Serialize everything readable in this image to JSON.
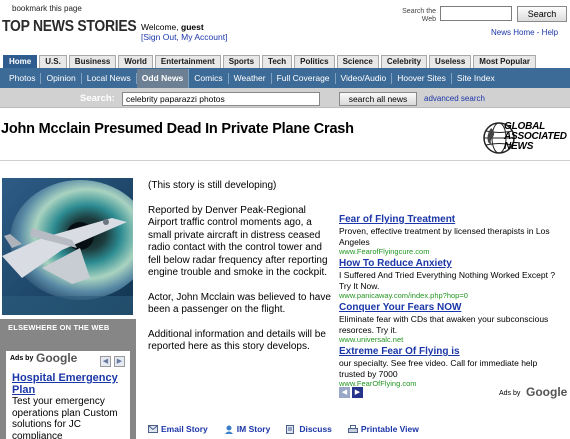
{
  "top": {
    "bookmark": "bookmark this page",
    "logo": "TOP NEWS STORIES",
    "welcome_prefix": "Welcome, ",
    "username": "guest",
    "sign_out": "[Sign Out, My Account]",
    "search_label": "Search the Web",
    "search_value": "",
    "search_button": "Search",
    "links": "News Home - Help"
  },
  "tabs": [
    {
      "label": "Home",
      "active": true
    },
    {
      "label": "U.S."
    },
    {
      "label": "Business"
    },
    {
      "label": "World"
    },
    {
      "label": "Entertainment"
    },
    {
      "label": "Sports"
    },
    {
      "label": "Tech"
    },
    {
      "label": "Politics"
    },
    {
      "label": "Science"
    },
    {
      "label": "Celebrity"
    },
    {
      "label": "Useless"
    },
    {
      "label": "Most Popular"
    }
  ],
  "subnav": [
    {
      "label": "Photos"
    },
    {
      "label": "Opinion"
    },
    {
      "label": "Local News"
    },
    {
      "label": "Odd News",
      "active": true
    },
    {
      "label": "Comics"
    },
    {
      "label": "Weather"
    },
    {
      "label": "Full Coverage"
    },
    {
      "label": "Video/Audio"
    },
    {
      "label": "Hoover Sites"
    },
    {
      "label": "Site Index"
    }
  ],
  "news_search": {
    "label": "Search:",
    "value": "celebrity paparazzi photos",
    "button": "search all news",
    "advanced": "advanced search"
  },
  "headline": "John Mcclain Presumed Dead In Private Plane Crash",
  "source_logo": {
    "line1": "GLOBAL",
    "line2": "ASSOCIATED",
    "line3": "NEWS"
  },
  "story": [
    "(This story is still developing)",
    "Reported by Denver Peak-Regional Airport traffic control moments ago, a small private aircraft in distress ceased radio contact with the control tower and fell below radar frequency after reporting engine trouble and smoke in the cockpit.",
    "Actor, John Mcclain was believed to have been a passenger on the flight.",
    "Additional information and details will be reported here as this story develops."
  ],
  "elsewhere": {
    "title": "ELSEWHERE ON THE WEB",
    "ads_by": "Ads by",
    "google": "Google",
    "ad_title": "Hospital Emergency Plan",
    "ad_body": "Test your emergency operations plan Custom solutions for JC compliance"
  },
  "ads": [
    {
      "title": "Fear of Flying Treatment",
      "body": "Proven, effective treatment by licensed therapists in Los Angeles",
      "url": "www.FearofFlyingcure.com"
    },
    {
      "title": "How To Reduce Anxiety",
      "body": "I Suffered And Tried Everything Nothing Worked Except ?Try It Now.",
      "url": "www.panicaway.com/index.php?hop=0"
    },
    {
      "title": "Conquer Your Fears NOW",
      "body": "Eliminate fear with CDs that awaken your subconscious resorces. Try it.",
      "url": "www.universalc.net"
    },
    {
      "title": "Extreme Fear Of Flying is",
      "body": "our specialty. See free video. Call for immediate help trusted by 7000",
      "url": "www.FearOfFlying.com"
    }
  ],
  "ads_footer": {
    "ads_by": "Ads by",
    "google": "Google"
  },
  "actions": [
    "Email Story",
    "IM Story",
    "Discuss",
    "Printable View"
  ],
  "colors": {
    "nav_blue": "#3d6b98",
    "link": "#1b36a8",
    "ad_url": "#239623"
  }
}
